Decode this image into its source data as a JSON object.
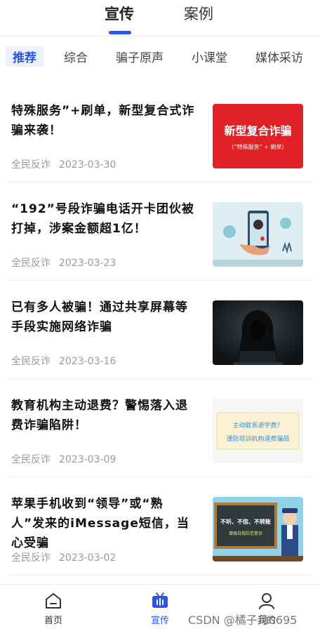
{
  "top_tabs": [
    {
      "label": "宣传",
      "active": true
    },
    {
      "label": "案例",
      "active": false
    }
  ],
  "categories": [
    {
      "label": "推荐",
      "active": true
    },
    {
      "label": "综合"
    },
    {
      "label": "骗子原声"
    },
    {
      "label": "小课堂"
    },
    {
      "label": "媒体采访"
    }
  ],
  "articles": [
    {
      "title": "特殊服务”+刷单，新型复合式诈骗来袭！",
      "source": "全民反诈",
      "date": "2023-03-30",
      "thumb": {
        "type": "red-banner",
        "headline": "新型复合诈骗",
        "sub": "（“特殊服务” + 刷单）"
      }
    },
    {
      "title": "“192”号段诈骗电话开卡团伙被打掉，涉案金额超1亿！",
      "source": "全民反诈",
      "date": "2023-03-23",
      "thumb": {
        "type": "phone-illustration"
      }
    },
    {
      "title": "已有多人被骗！通过共享屏幕等手段实施网络诈骗",
      "source": "全民反诈",
      "date": "2023-03-16",
      "thumb": {
        "type": "hacker-photo"
      }
    },
    {
      "title": "教育机构主动退费？警惕落入退费诈骗陷阱！",
      "source": "全民反诈",
      "date": "2023-03-09",
      "thumb": {
        "type": "note-card",
        "line1": "主动联系退学费？",
        "line2": "谨防培训机构退费骗局"
      }
    },
    {
      "title": "苹果手机收到“领导”或“熟人”发来的iMessage短信，当心受骗",
      "source": "全民反诈",
      "date": "2023-03-02",
      "thumb": {
        "type": "blackboard-police",
        "line1": "不听、不信、不转账",
        "line2": "增强自我防范意识"
      }
    }
  ],
  "bottom_nav": [
    {
      "label": "首页",
      "icon": "home-icon",
      "active": false
    },
    {
      "label": "宣传",
      "icon": "broadcast-icon",
      "active": true
    },
    {
      "label": "我的",
      "icon": "user-icon",
      "active": false
    }
  ],
  "watermark": "CSDN @橘子月0695",
  "colors": {
    "accent": "#2a55e5",
    "thumb_red": "#e02226",
    "meta_gray": "#9a9a9a"
  }
}
